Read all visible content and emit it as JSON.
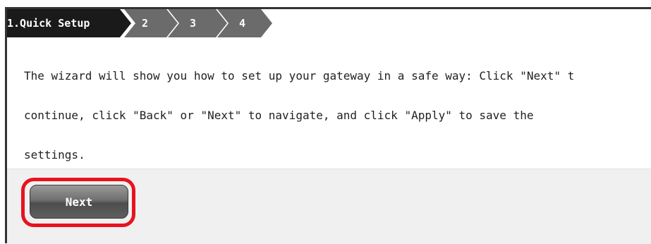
{
  "wizard": {
    "steps": [
      {
        "label": "1.Quick Setup",
        "active": true
      },
      {
        "label": "2",
        "active": false
      },
      {
        "label": "3",
        "active": false
      },
      {
        "label": "4",
        "active": false
      }
    ],
    "description_lines": [
      "The wizard will show you how to set up your gateway in a safe way: Click \"Next\" t",
      "continue, click \"Back\" or \"Next\" to navigate, and click \"Apply\" to save the",
      "settings."
    ],
    "next_label": "Next"
  },
  "colors": {
    "step_active": "#1a1a1a",
    "step_inactive": "#6b6b6b",
    "highlight": "#e8121f",
    "footer_bg": "#f0f0f0"
  }
}
